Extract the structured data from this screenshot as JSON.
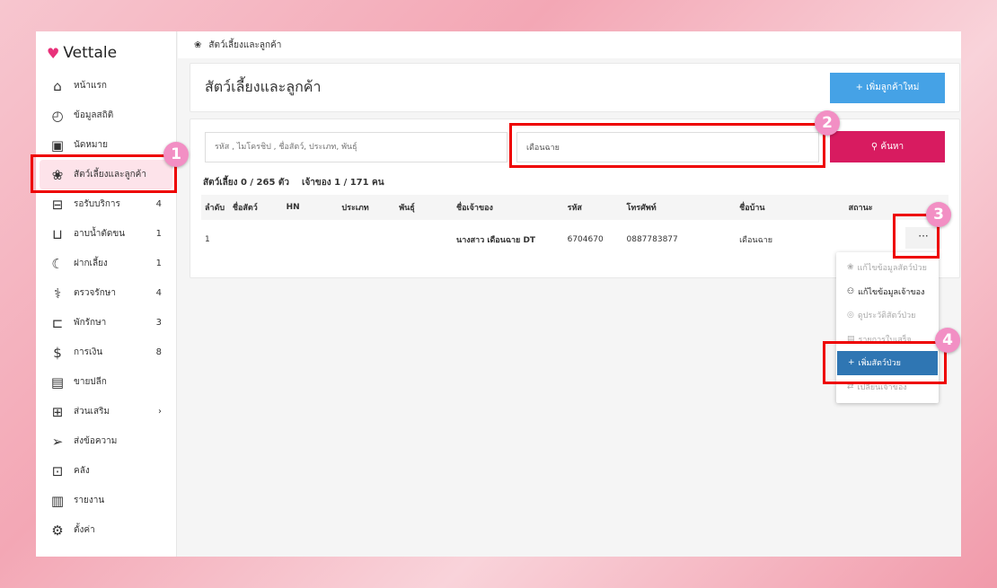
{
  "app": {
    "name": "Vettale"
  },
  "sidebar": {
    "items": [
      {
        "label": "หน้าแรก",
        "icon": "home-icon",
        "glyph": "⌂",
        "count": ""
      },
      {
        "label": "ข้อมูลสถิติ",
        "icon": "gauge-icon",
        "glyph": "◴",
        "count": ""
      },
      {
        "label": "นัดหมาย",
        "icon": "calendar-icon",
        "glyph": "▣",
        "count": ""
      },
      {
        "label": "สัตว์เลี้ยงและลูกค้า",
        "icon": "paw-icon",
        "glyph": "❀",
        "count": ""
      },
      {
        "label": "รอรับบริการ",
        "icon": "sofa-icon",
        "glyph": "⊟",
        "count": "4"
      },
      {
        "label": "อาบน้ำตัดขน",
        "icon": "bathtub-icon",
        "glyph": "⊔",
        "count": "1"
      },
      {
        "label": "ฝากเลี้ยง",
        "icon": "moon-icon",
        "glyph": "☾",
        "count": "1"
      },
      {
        "label": "ตรวจรักษา",
        "icon": "stethoscope-icon",
        "glyph": "⚕",
        "count": "4"
      },
      {
        "label": "พักรักษา",
        "icon": "bed-icon",
        "glyph": "⊏",
        "count": "3"
      },
      {
        "label": "การเงิน",
        "icon": "money-icon",
        "glyph": "$",
        "count": "8"
      },
      {
        "label": "ขายปลีก",
        "icon": "register-icon",
        "glyph": "▤",
        "count": ""
      },
      {
        "label": "ส่วนเสริม",
        "icon": "plus-box-icon",
        "glyph": "⊞",
        "count": "›"
      },
      {
        "label": "ส่งข้อความ",
        "icon": "send-icon",
        "glyph": "➢",
        "count": ""
      },
      {
        "label": "คลัง",
        "icon": "archive-icon",
        "glyph": "⊡",
        "count": ""
      },
      {
        "label": "รายงาน",
        "icon": "chart-icon",
        "glyph": "▥",
        "count": ""
      },
      {
        "label": "ตั้งค่า",
        "icon": "gear-icon",
        "glyph": "⚙",
        "count": ""
      }
    ]
  },
  "breadcrumb": "สัตว์เลี้ยงและลูกค้า",
  "header": {
    "title": "สัตว์เลี้ยงและลูกค้า",
    "add_label": "+ เพิ่มลูกค้าใหม่"
  },
  "search": {
    "placeholder": "รหัส , ไมโครชิป , ชื่อสัตว์, ประเภท, พันธุ์",
    "owner_value": "เดือนฉาย",
    "button": "ค้นหา"
  },
  "counts": {
    "pets": "สัตว์เลี้ยง 0 / 265 ตัว",
    "owners": "เจ้าของ 1 / 171 คน"
  },
  "table": {
    "headers": [
      "ลำดับ",
      "ชื่อสัตว์",
      "HN",
      "ประเภท",
      "พันธุ์",
      "ชื่อเจ้าของ",
      "รหัส",
      "โทรศัพท์",
      "ชื่อบ้าน",
      "สถานะ"
    ],
    "rows": [
      [
        "1",
        "",
        "",
        "",
        "",
        "นางสาว เดือนฉาย DT",
        "6704670",
        "0887783877",
        "เดือนฉาย",
        ""
      ]
    ]
  },
  "more_label": "···",
  "menu": [
    {
      "label": "แก้ไขข้อมูลสัตว์ป่วย",
      "icon": "paw-icon",
      "glyph": "❀"
    },
    {
      "label": "แก้ไขข้อมูลเจ้าของ",
      "icon": "user-icon",
      "glyph": "⚇"
    },
    {
      "label": "ดูประวัติสัตว์ป่วย",
      "icon": "history-icon",
      "glyph": "◎"
    },
    {
      "label": "รายการใบเสร็จ",
      "icon": "receipt-icon",
      "glyph": "▤"
    },
    {
      "label": "เพิ่มสัตว์ป่วย",
      "icon": "plus-icon",
      "glyph": "+"
    },
    {
      "label": "เปลี่ยนเจ้าของ",
      "icon": "swap-icon",
      "glyph": "⇄"
    }
  ],
  "steps": [
    "1",
    "2",
    "3",
    "4"
  ]
}
